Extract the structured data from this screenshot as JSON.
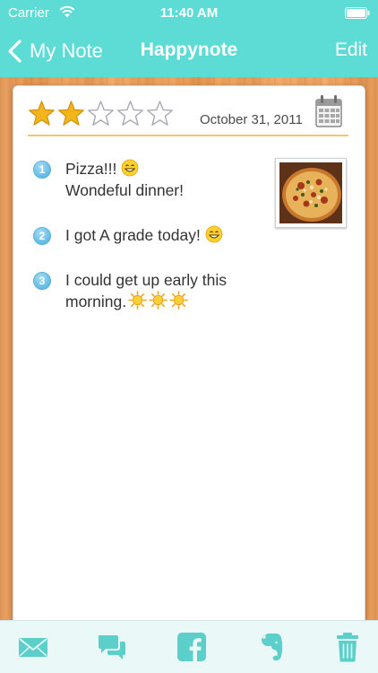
{
  "status_bar": {
    "carrier": "Carrier",
    "time": "11:40 AM"
  },
  "nav": {
    "back_label": "My Note",
    "title": "Happynote",
    "edit_label": "Edit"
  },
  "note": {
    "rating": 2,
    "rating_max": 5,
    "date": "October 31, 2011",
    "entries": [
      {
        "number": "1",
        "line1": "Pizza!!!",
        "line2": "Wondeful dinner!"
      },
      {
        "number": "2",
        "line1": "I got A grade today!"
      },
      {
        "number": "3",
        "line1": "I could get up early this",
        "line2": "morning."
      }
    ]
  },
  "colors": {
    "header": "#5ddbd5",
    "divider": "#f1c76a",
    "toolbar_icon": "#5ccfcb",
    "star_filled": "#f3b51c",
    "table_wood": "#e89b59"
  },
  "toolbar": {
    "icons": [
      "mail-icon",
      "chat-icon",
      "facebook-icon",
      "evernote-icon",
      "trash-icon"
    ]
  }
}
